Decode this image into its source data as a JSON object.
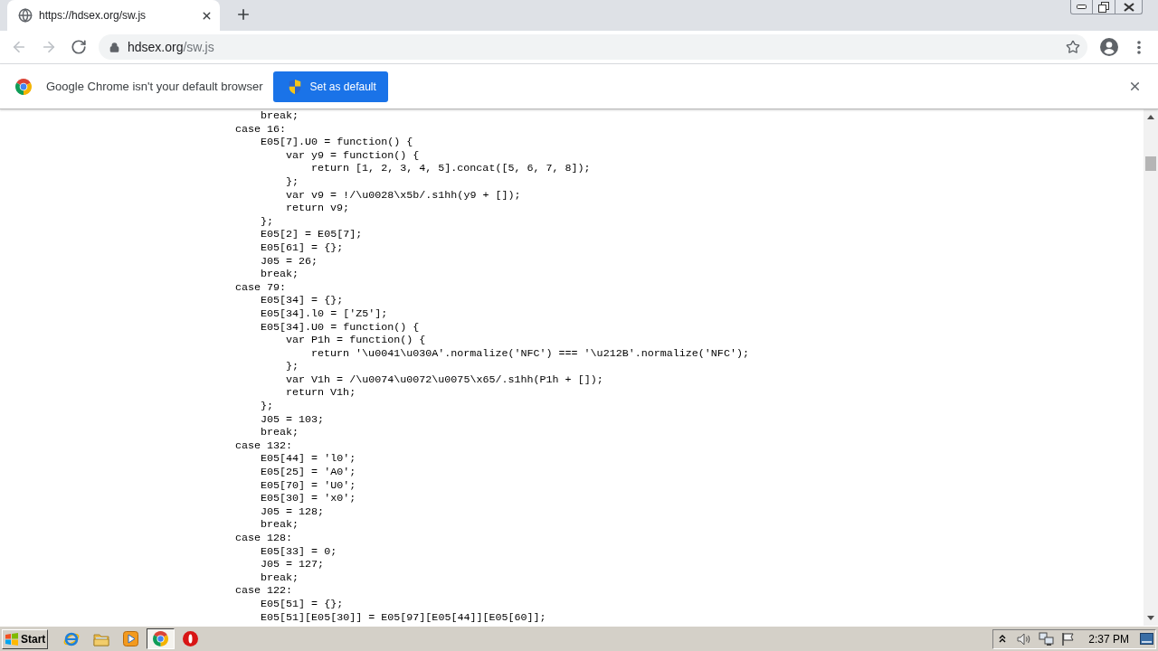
{
  "tabs": [
    {
      "title": "https://hdsex.org/sw.js",
      "selected": true
    }
  ],
  "toolbar": {
    "nav_buttons": [
      {
        "kind": "back",
        "disabled": true
      },
      {
        "kind": "forward",
        "disabled": true
      },
      {
        "kind": "reload",
        "disabled": false
      }
    ],
    "address": {
      "host": "hdsex.org",
      "path": "/sw.js"
    }
  },
  "infobar": {
    "message": "Google Chrome isn't your default browser",
    "button": "Set as default"
  },
  "code_lines": [
    {
      "children": [
        {
          "text": "break;"
        }
      ]
    },
    {
      "text": "case 16:",
      "children": [
        {
          "text": "E05[7].U0 = function() {",
          "children": [
            {
              "text": "var y9 = function() {",
              "children": [
                {
                  "text": "return [1, 2, 3, 4, 5].concat([5, 6, 7, 8]);"
                }
              ]
            },
            {
              "text": "};"
            },
            {
              "text": "var v9 = !/\\u0028\\x5b/.s1hh(y9 + []);"
            },
            {
              "text": "return v9;"
            }
          ]
        },
        {
          "text": "};"
        },
        {
          "text": "E05[2] = E05[7];"
        },
        {
          "text": "E05[61] = {};"
        },
        {
          "text": "J05 = 26;"
        },
        {
          "text": "break;"
        }
      ]
    },
    {
      "text": "case 79:",
      "children": [
        {
          "text": "E05[34] = {};"
        },
        {
          "text": "E05[34].l0 = ['Z5'];"
        },
        {
          "text": "E05[34].U0 = function() {",
          "children": [
            {
              "text": "var P1h = function() {",
              "children": [
                {
                  "text": "return '\\u0041\\u030A'.normalize('NFC') === '\\u212B'.normalize('NFC');"
                }
              ]
            },
            {
              "text": "};"
            },
            {
              "text": "var V1h = /\\u0074\\u0072\\u0075\\x65/.s1hh(P1h + []);"
            },
            {
              "text": "return V1h;"
            }
          ]
        },
        {
          "text": "};"
        },
        {
          "text": "J05 = 103;"
        },
        {
          "text": "break;"
        }
      ]
    },
    {
      "text": "case 132:",
      "children": [
        {
          "text": "E05[44] = 'l0';"
        },
        {
          "text": "E05[25] = 'A0';"
        },
        {
          "text": "E05[70] = 'U0';"
        },
        {
          "text": "E05[30] = 'x0';"
        },
        {
          "text": "J05 = 128;"
        },
        {
          "text": "break;"
        }
      ]
    },
    {
      "text": "case 128:",
      "children": [
        {
          "text": "E05[33] = 0;"
        },
        {
          "text": "J05 = 127;"
        },
        {
          "text": "break;"
        }
      ]
    },
    {
      "text": "case 122:",
      "children": [
        {
          "text": "E05[51] = {};"
        },
        {
          "text": "E05[51][E05[30]] = E05[97][E05[44]][E05[60]];"
        }
      ]
    }
  ],
  "taskbar": {
    "start": "Start",
    "quick_launch": [
      {
        "kind": "ie",
        "selected": false
      },
      {
        "kind": "folder",
        "selected": false
      },
      {
        "kind": "media",
        "selected": false
      },
      {
        "kind": "chrome",
        "selected": true
      },
      {
        "kind": "ring",
        "selected": false
      }
    ],
    "clock": "2:37 PM"
  }
}
